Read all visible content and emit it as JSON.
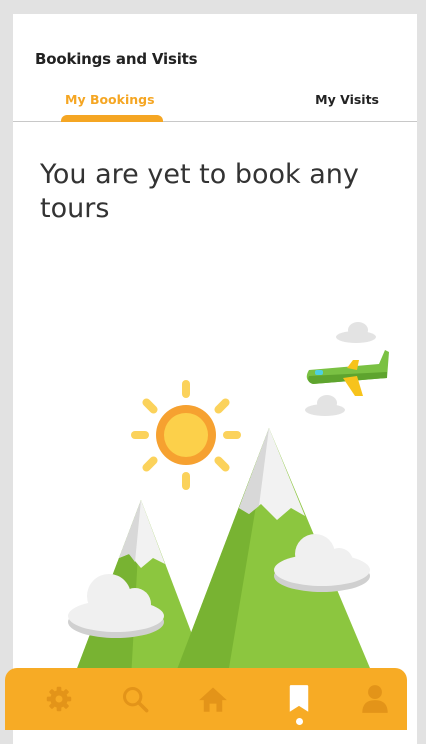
{
  "header": {
    "title": "Bookings and Visits"
  },
  "tabs": [
    {
      "label": "My Bookings",
      "active": true
    },
    {
      "label": "My Visits",
      "active": false
    }
  ],
  "empty_state": {
    "message": "You are yet to book any tours"
  },
  "bottom_nav": {
    "items": [
      {
        "icon": "settings-gear-icon",
        "active": false
      },
      {
        "icon": "search-icon",
        "active": false
      },
      {
        "icon": "home-icon",
        "active": false
      },
      {
        "icon": "bookmark-icon",
        "active": true
      },
      {
        "icon": "profile-icon",
        "active": false
      }
    ]
  },
  "colors": {
    "accent": "#f5a623",
    "nav_background": "#f7ab25",
    "nav_icon_inactive": "#e39419",
    "nav_icon_active": "#ffffff",
    "mountain_green": "#8cc63f",
    "sun": "#fbc531"
  }
}
